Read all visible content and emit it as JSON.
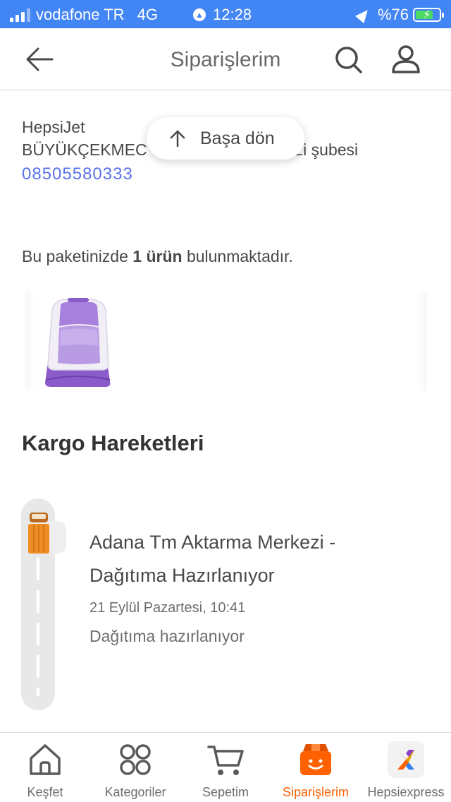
{
  "status_bar": {
    "carrier": "vodafone TR",
    "network": "4G",
    "time": "12:28",
    "battery": "%76",
    "battery_level": 0.76
  },
  "header": {
    "title": "Siparişlerim",
    "icons": [
      "back-arrow-icon",
      "search-icon",
      "user-icon"
    ]
  },
  "delivery": {
    "company": "HepsiJet",
    "branch": "BÜYÜKÇEKMEC",
    "branch_suffix": "zi şubesi",
    "phone": "08505580333"
  },
  "back_to_top": {
    "label": "Başa dön"
  },
  "package": {
    "prefix": "Bu paketinizde ",
    "count": "1 ürün",
    "suffix": " bulunmaktadır."
  },
  "shipping": {
    "title": "Kargo Hareketleri",
    "events": [
      {
        "title": "Adana Tm Aktarma Merkezi - Dağıtıma Hazırlanıyor",
        "date": "21 Eylül Pazartesi, 10:41",
        "description": "Dağıtıma hazırlanıyor"
      }
    ]
  },
  "tabbar": {
    "items": [
      {
        "label": "Keşfet",
        "icon": "home-icon"
      },
      {
        "label": "Kategoriler",
        "icon": "grid-icon"
      },
      {
        "label": "Sepetim",
        "icon": "cart-icon"
      },
      {
        "label": "Siparişlerim",
        "icon": "package-icon",
        "active": true
      },
      {
        "label": "Hepsiexpress",
        "icon": "hepsiexpress-logo-icon"
      }
    ]
  },
  "colors": {
    "status_bar": "#4285f4",
    "accent": "#ff6000",
    "link": "#5b73e8"
  }
}
